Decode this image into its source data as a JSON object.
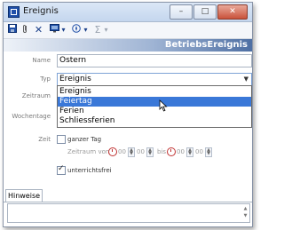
{
  "window": {
    "title": "Ereignis",
    "minimize_glyph": "–",
    "maximize_glyph": "□",
    "close_glyph": "✕"
  },
  "toolbar": {
    "save_icon": "floppy-disk",
    "attach_icon": "paperclip",
    "delete_glyph": "✕",
    "monitor_icon": "monitor",
    "dropdown_glyph": "▾",
    "compass_icon": "compass",
    "sigma_glyph": "Σ"
  },
  "banner": {
    "title": "BetriebsEreignis"
  },
  "form": {
    "name_label": "Name",
    "name_value": "Ostern",
    "typ_label": "Typ",
    "typ_value": "Ereignis",
    "zeitraum_label": "Zeitraum",
    "wochentage_label": "Wochentage",
    "zeit_label": "Zeit"
  },
  "dropdown": {
    "options": [
      "Ereignis",
      "Feiertag",
      "Ferien",
      "Schliessferien"
    ],
    "selected_index": 1
  },
  "time": {
    "ganzer_tag_label": "ganzer Tag",
    "zeitraum_von_label": "Zeitraum von",
    "bis_label": "bis",
    "von_hour": "00",
    "von_minute": "00",
    "bis_hour": "00",
    "bis_minute": "00"
  },
  "unterrichtsfrei": {
    "label": "unterrichtsfrei",
    "checked": true
  },
  "tabs": {
    "hinweise": "Hinweise"
  },
  "colors": {
    "accent": "#3a78d8",
    "banner_dark": "#4e6fa3",
    "clock_red": "#c03030"
  }
}
